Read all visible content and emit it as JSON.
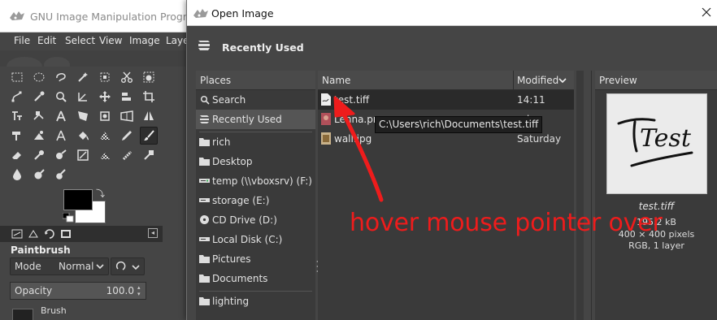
{
  "gimp": {
    "title": "GNU Image Manipulation Program",
    "menus": [
      "File",
      "Edit",
      "Select",
      "View",
      "Image",
      "Laye"
    ],
    "tool_options": {
      "tool_name": "Paintbrush",
      "mode_label": "Mode",
      "mode_value": "Normal",
      "opacity_label": "Opacity",
      "opacity_value": "100.0",
      "brush_label": "Brush"
    },
    "colors": {
      "foreground": "#000000",
      "background": "#ffffff"
    }
  },
  "dialog": {
    "title": "Open Image",
    "location": "Recently Used",
    "places_header": "Places",
    "places": [
      {
        "label": "Search",
        "icon": "search-icon"
      },
      {
        "label": "Recently Used",
        "icon": "recent-icon",
        "selected": true
      },
      {
        "label": "rich",
        "icon": "folder-icon"
      },
      {
        "label": "Desktop",
        "icon": "folder-icon"
      },
      {
        "label": "temp (\\\\vboxsrv) (F:)",
        "icon": "network-drive-icon"
      },
      {
        "label": "storage (E:)",
        "icon": "drive-icon"
      },
      {
        "label": "CD Drive (D:)",
        "icon": "cd-drive-icon"
      },
      {
        "label": "Local Disk (C:)",
        "icon": "drive-icon"
      },
      {
        "label": "Pictures",
        "icon": "folder-icon"
      },
      {
        "label": "Documents",
        "icon": "folder-icon"
      },
      {
        "label": "lighting",
        "icon": "folder-icon"
      }
    ],
    "columns": {
      "name": "Name",
      "modified": "Modified"
    },
    "files": [
      {
        "name": "test.tiff",
        "modified": "14:11",
        "selected": true
      },
      {
        "name": "Lenna.pn",
        "modified": "nday"
      },
      {
        "name": "wall.jpg",
        "modified": "Saturday"
      }
    ],
    "preview": {
      "header": "Preview",
      "file_name": "test.tiff",
      "size": "195.2 kB",
      "dimensions": "400 × 400 pixels",
      "mode": "RGB, 1 layer",
      "thumbnail_text": "Test"
    },
    "tooltip": "C:\\Users\\rich\\Documents\\test.tiff"
  },
  "annotation": {
    "text": "hover mouse pointer over",
    "color": "#ee1c1c"
  }
}
